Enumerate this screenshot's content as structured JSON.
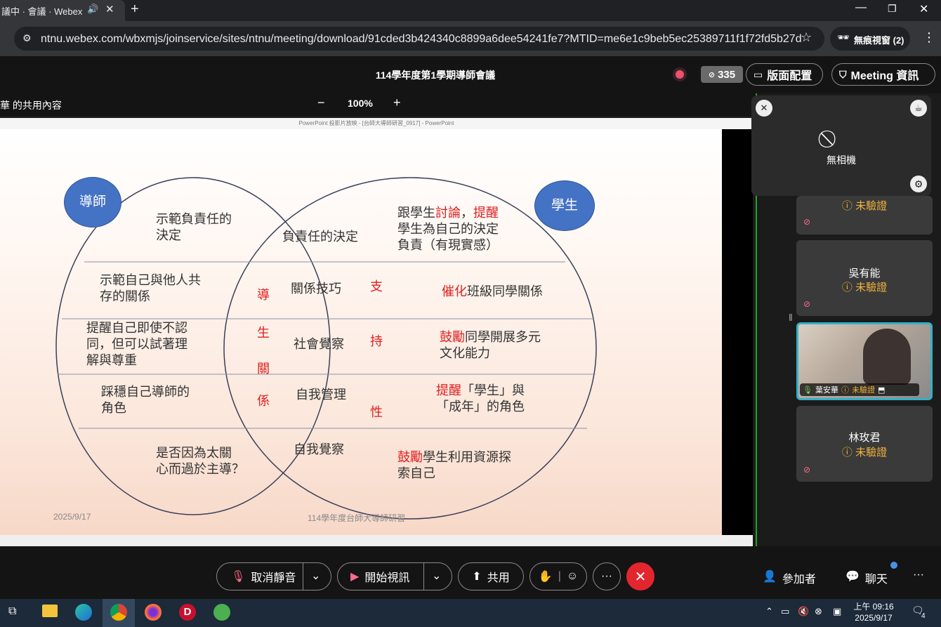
{
  "browser": {
    "tab_title": "議中 · 會議 · Webex",
    "url": "ntnu.webex.com/wbxmjs/joinservice/sites/ntnu/meeting/download/91cded3b424340c8899a6dee54241fe7?MTID=me6e1c9beb5ec25389711f1f72fd5b27d",
    "incognito_label": "無痕視窗 (2)"
  },
  "header": {
    "title": "114學年度第1學期導師會議",
    "participant_count": "335",
    "layout_label": "版面配置",
    "meeting_info_label": "Meeting 資訊"
  },
  "share": {
    "label": "華 的共用內容",
    "zoom": "100%",
    "minus": "−",
    "plus": "+"
  },
  "slide": {
    "window_title": "PowerPoint 投影片放映 - [台師大導師研習_0917] - PowerPoint",
    "bubble_left": "導師",
    "bubble_right": "學生",
    "left": [
      "示範負責任的\n決定",
      "示範自己與他人共\n存的關係",
      "提醒自己即使不認\n同，但可以試著理\n解與尊重",
      "踩穩自己導師的\n角色",
      "是否因為太關\n心而過於主導？"
    ],
    "center": [
      "負責任的決定",
      "關係技巧",
      "社會覺察",
      "自我管理",
      "自我覺察"
    ],
    "vertical_left": [
      "導",
      "生",
      "關",
      "係"
    ],
    "vertical_right": [
      "支",
      "持",
      "性"
    ],
    "right": [
      {
        "red1": "討論",
        "red2": "提醒",
        "pre": "跟學生",
        "mid": "，",
        "post": "\n學生為自己的決定\n負責（有現實感）"
      },
      {
        "red": "催化",
        "rest": "班級同學關係"
      },
      {
        "red": "鼓勵",
        "rest": "同學開展多元\n文化能力"
      },
      {
        "red": "提醒",
        "rest": "「學生」與\n「成年」的角色"
      },
      {
        "red": "鼓勵",
        "rest": "學生利用資源探\n索自己"
      }
    ],
    "footer_date": "2025/9/17",
    "footer_title": "114學年度台師大導師研習"
  },
  "self_view": {
    "label": "無相機"
  },
  "participants": [
    {
      "name": "",
      "status": "未驗證"
    },
    {
      "name": "吳有能",
      "status": "未驗證"
    },
    {
      "name": "葉安華",
      "status": "未驗證"
    },
    {
      "name": "林玫君",
      "status": "未驗證"
    }
  ],
  "controls": {
    "unmute": "取消靜音",
    "start_video": "開始視訊",
    "share": "共用",
    "more": "···",
    "participants": "參加者",
    "chat": "聊天"
  },
  "taskbar": {
    "time": "上午 09:16",
    "date": "2025/9/17",
    "notifications": "4"
  },
  "colors": {
    "accent_red": "#e02020",
    "bubble_blue": "#4472c4",
    "unverified": "#f2b33d",
    "end_call": "#e3262e"
  }
}
